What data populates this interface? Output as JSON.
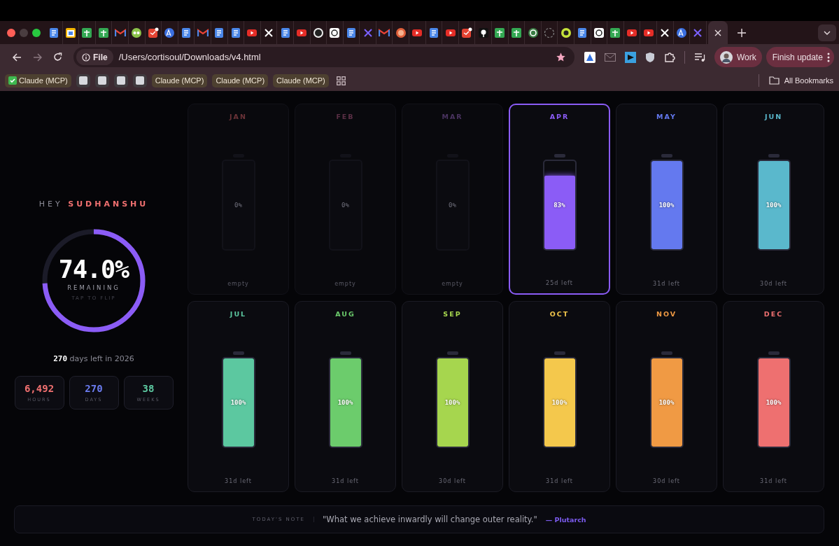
{
  "browser": {
    "tabs": [
      {
        "kind": "doc",
        "selected": false
      },
      {
        "kind": "calendar",
        "selected": false
      },
      {
        "kind": "sheet",
        "selected": false
      },
      {
        "kind": "sheet",
        "selected": false
      },
      {
        "kind": "mail",
        "selected": false
      },
      {
        "kind": "owl",
        "selected": false
      },
      {
        "kind": "todo",
        "selected": false
      },
      {
        "kind": "translate",
        "selected": false
      },
      {
        "kind": "doc",
        "selected": false
      },
      {
        "kind": "mail",
        "selected": false
      },
      {
        "kind": "doc",
        "selected": false
      },
      {
        "kind": "doc",
        "selected": false
      },
      {
        "kind": "video",
        "selected": false
      },
      {
        "kind": "cross",
        "selected": false
      },
      {
        "kind": "doc",
        "selected": false
      },
      {
        "kind": "video",
        "selected": false
      },
      {
        "kind": "github",
        "selected": false
      },
      {
        "kind": "openai",
        "selected": false
      },
      {
        "kind": "doc",
        "selected": false
      },
      {
        "kind": "purplecross",
        "selected": false
      },
      {
        "kind": "mail",
        "selected": false
      },
      {
        "kind": "badge",
        "selected": false
      },
      {
        "kind": "video",
        "selected": false
      },
      {
        "kind": "doc",
        "selected": false
      },
      {
        "kind": "video",
        "selected": false
      },
      {
        "kind": "todo",
        "selected": false
      },
      {
        "kind": "pin",
        "selected": false
      },
      {
        "kind": "sheet",
        "selected": false
      },
      {
        "kind": "sheet",
        "selected": false
      },
      {
        "kind": "ringc",
        "selected": false
      },
      {
        "kind": "dashed",
        "selected": false
      },
      {
        "kind": "greencircle",
        "selected": false
      },
      {
        "kind": "doc",
        "selected": false
      },
      {
        "kind": "openai",
        "selected": false
      },
      {
        "kind": "sheet",
        "selected": false
      },
      {
        "kind": "video",
        "selected": false
      },
      {
        "kind": "video",
        "selected": false
      },
      {
        "kind": "cross",
        "selected": false
      },
      {
        "kind": "translate",
        "selected": false
      },
      {
        "kind": "purplecross",
        "selected": false
      },
      {
        "selected": true
      }
    ],
    "url_chip": "File",
    "url": "/Users/cortisoul/Downloads/v4.html",
    "profile": "Work",
    "update_button": "Finish update",
    "bookmarks": [
      {
        "kind": "check",
        "label": "Claude (MCP)"
      },
      {
        "kind": "blank"
      },
      {
        "kind": "blank"
      },
      {
        "kind": "blank"
      },
      {
        "kind": "blank"
      },
      {
        "kind": "plain",
        "label": "Claude (MCP)"
      },
      {
        "kind": "plain",
        "label": "Claude (MCP)"
      },
      {
        "kind": "plain",
        "label": "Claude (MCP)"
      },
      {
        "kind": "apps"
      }
    ],
    "all_bookmarks": "All Bookmarks"
  },
  "greeting": {
    "prefix": "HEY",
    "name": "SUDHANSHU"
  },
  "ring": {
    "value": "74.0%",
    "label": "REMAINING",
    "hint": "TAP TO FLIP",
    "level": 0.74
  },
  "days_line": "**270** days left in 2026",
  "stats": [
    {
      "value": "6,492",
      "label": "HOURS",
      "color": "#f07070"
    },
    {
      "value": "270",
      "label": "DAYS",
      "color": "#6b7cf0"
    },
    {
      "value": "38",
      "label": "WEEKS",
      "color": "#5cc8a0"
    }
  ],
  "months": [
    {
      "name": "JAN",
      "color": "#6b3338",
      "level": 0,
      "percent": "0%",
      "footer": "empty",
      "selected": false
    },
    {
      "name": "FEB",
      "color": "#5a2f45",
      "level": 0,
      "percent": "0%",
      "footer": "empty",
      "selected": false
    },
    {
      "name": "MAR",
      "color": "#4a3360",
      "level": 0,
      "percent": "0%",
      "footer": "empty",
      "selected": false
    },
    {
      "name": "APR",
      "color": "#8b5cf6",
      "level": 0.83,
      "percent": "83%",
      "footer": "25d left",
      "selected": true
    },
    {
      "name": "MAY",
      "color": "#6479ef",
      "level": 1,
      "percent": "100%",
      "footer": "31d left",
      "selected": false
    },
    {
      "name": "JUN",
      "color": "#5ab8cc",
      "level": 1,
      "percent": "100%",
      "footer": "30d left",
      "selected": false
    },
    {
      "name": "JUL",
      "color": "#5cc8a0",
      "level": 1,
      "percent": "100%",
      "footer": "31d left",
      "selected": false
    },
    {
      "name": "AUG",
      "color": "#6ccc6c",
      "level": 1,
      "percent": "100%",
      "footer": "31d left",
      "selected": false
    },
    {
      "name": "SEP",
      "color": "#a6d64e",
      "level": 1,
      "percent": "100%",
      "footer": "30d left",
      "selected": false
    },
    {
      "name": "OCT",
      "color": "#f4c84c",
      "level": 1,
      "percent": "100%",
      "footer": "31d left",
      "selected": false
    },
    {
      "name": "NOV",
      "color": "#f09a44",
      "level": 1,
      "percent": "100%",
      "footer": "30d left",
      "selected": false
    },
    {
      "name": "DEC",
      "color": "#ee7070",
      "level": 1,
      "percent": "100%",
      "footer": "31d left",
      "selected": false
    }
  ],
  "note": {
    "label": "TODAY'S NOTE",
    "quote": "\"What we achieve inwardly will change outer reality.\"",
    "author": "— Plutarch"
  }
}
